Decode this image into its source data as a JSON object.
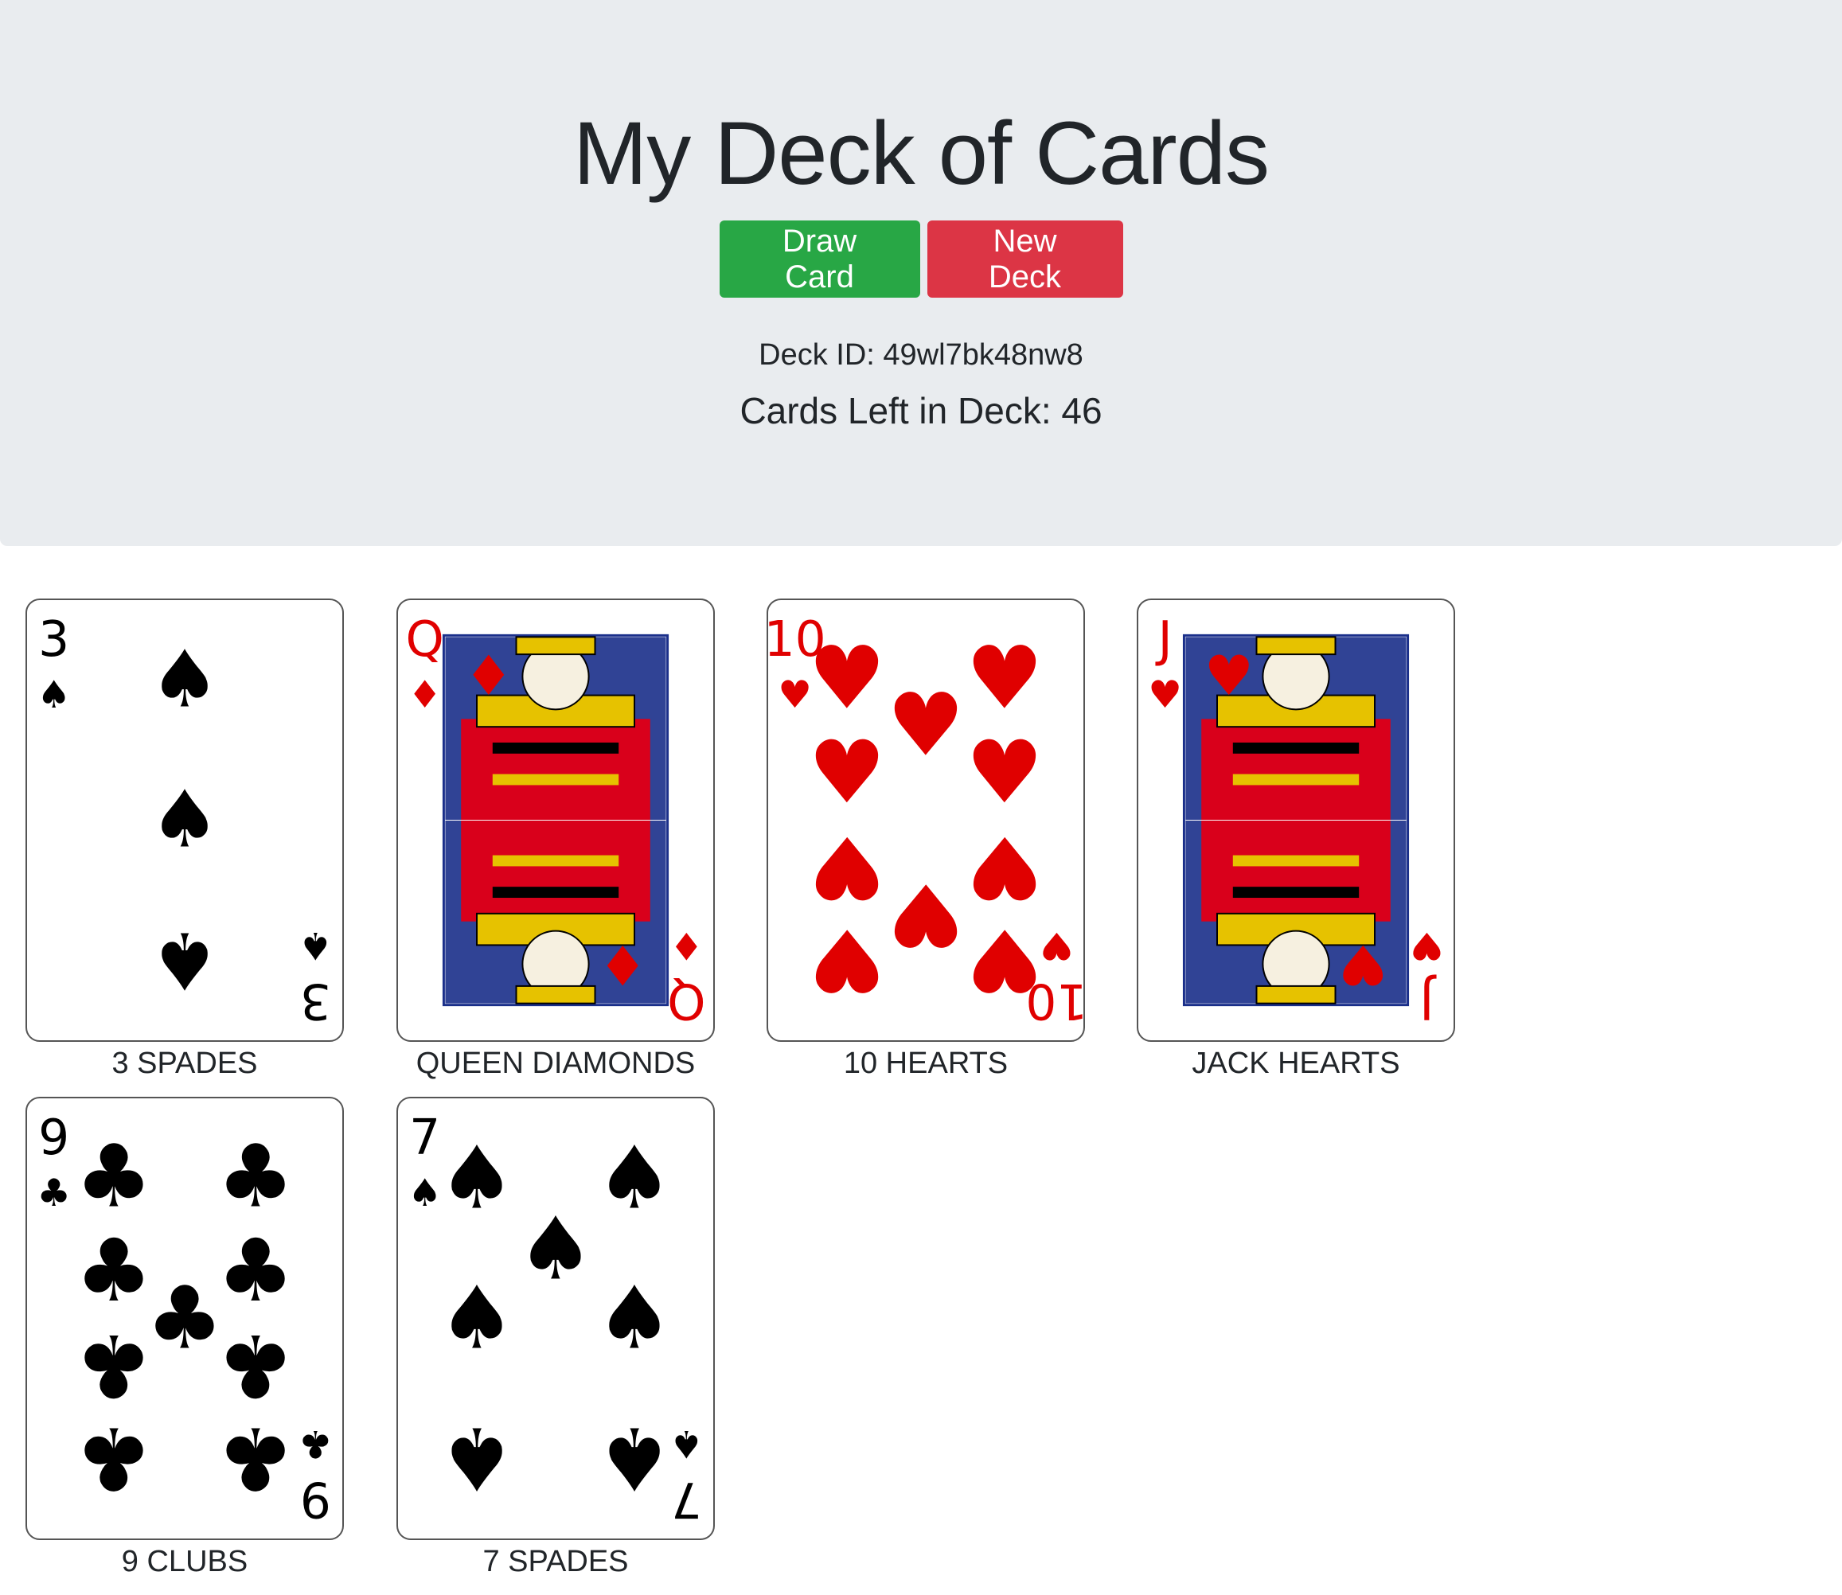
{
  "header": {
    "title": "My Deck of Cards",
    "draw_label": "Draw Card",
    "new_label": "New Deck",
    "deck_id": "Deck ID: 49wl7bk48nw8",
    "cards_left": "Cards Left in Deck: 46"
  },
  "colors": {
    "jumbotron": "#e9ecef",
    "draw_button": "#28a745",
    "new_button": "#dc3545",
    "red_suit": "#e00000",
    "black_suit": "#000000"
  },
  "cards": [
    {
      "rank": "3",
      "suit": "spades",
      "caption": "3 SPADES"
    },
    {
      "rank": "Q",
      "suit": "diamonds",
      "caption": "QUEEN DIAMONDS"
    },
    {
      "rank": "10",
      "suit": "hearts",
      "caption": "10 HEARTS"
    },
    {
      "rank": "J",
      "suit": "hearts",
      "caption": "JACK HEARTS"
    },
    {
      "rank": "9",
      "suit": "clubs",
      "caption": "9 CLUBS"
    },
    {
      "rank": "7",
      "suit": "spades",
      "caption": "7 SPADES"
    }
  ]
}
